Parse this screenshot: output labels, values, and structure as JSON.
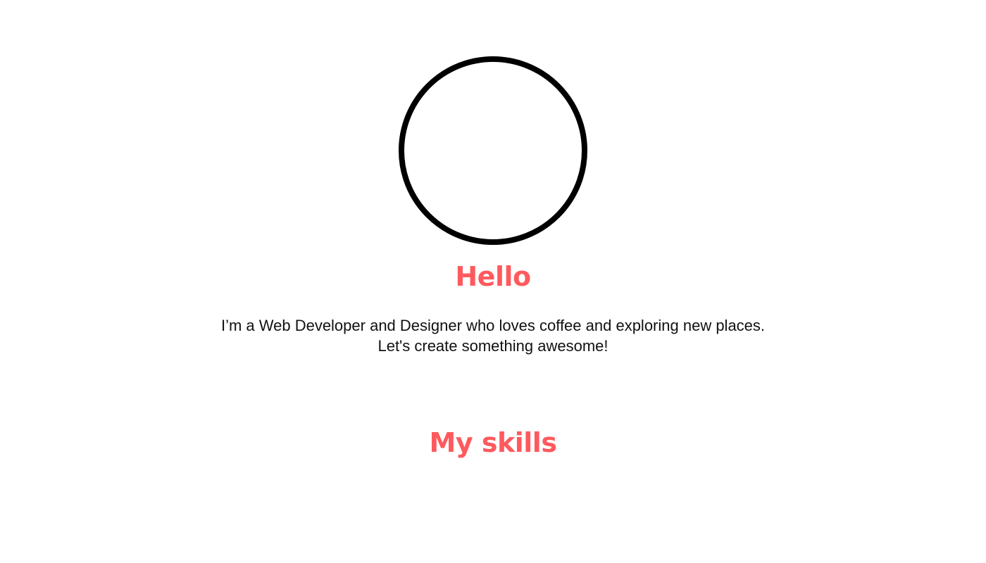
{
  "colors": {
    "accent": "#fe5a5e",
    "text": "#111111",
    "avatar_border": "#000000",
    "background": "#ffffff"
  },
  "profile": {
    "greeting": "Hello",
    "intro_line_1": "I’m a Web Developer and Designer who loves coffee and exploring new places.",
    "intro_line_2": "Let's create something awesome!"
  },
  "skills": {
    "title": "My skills"
  }
}
